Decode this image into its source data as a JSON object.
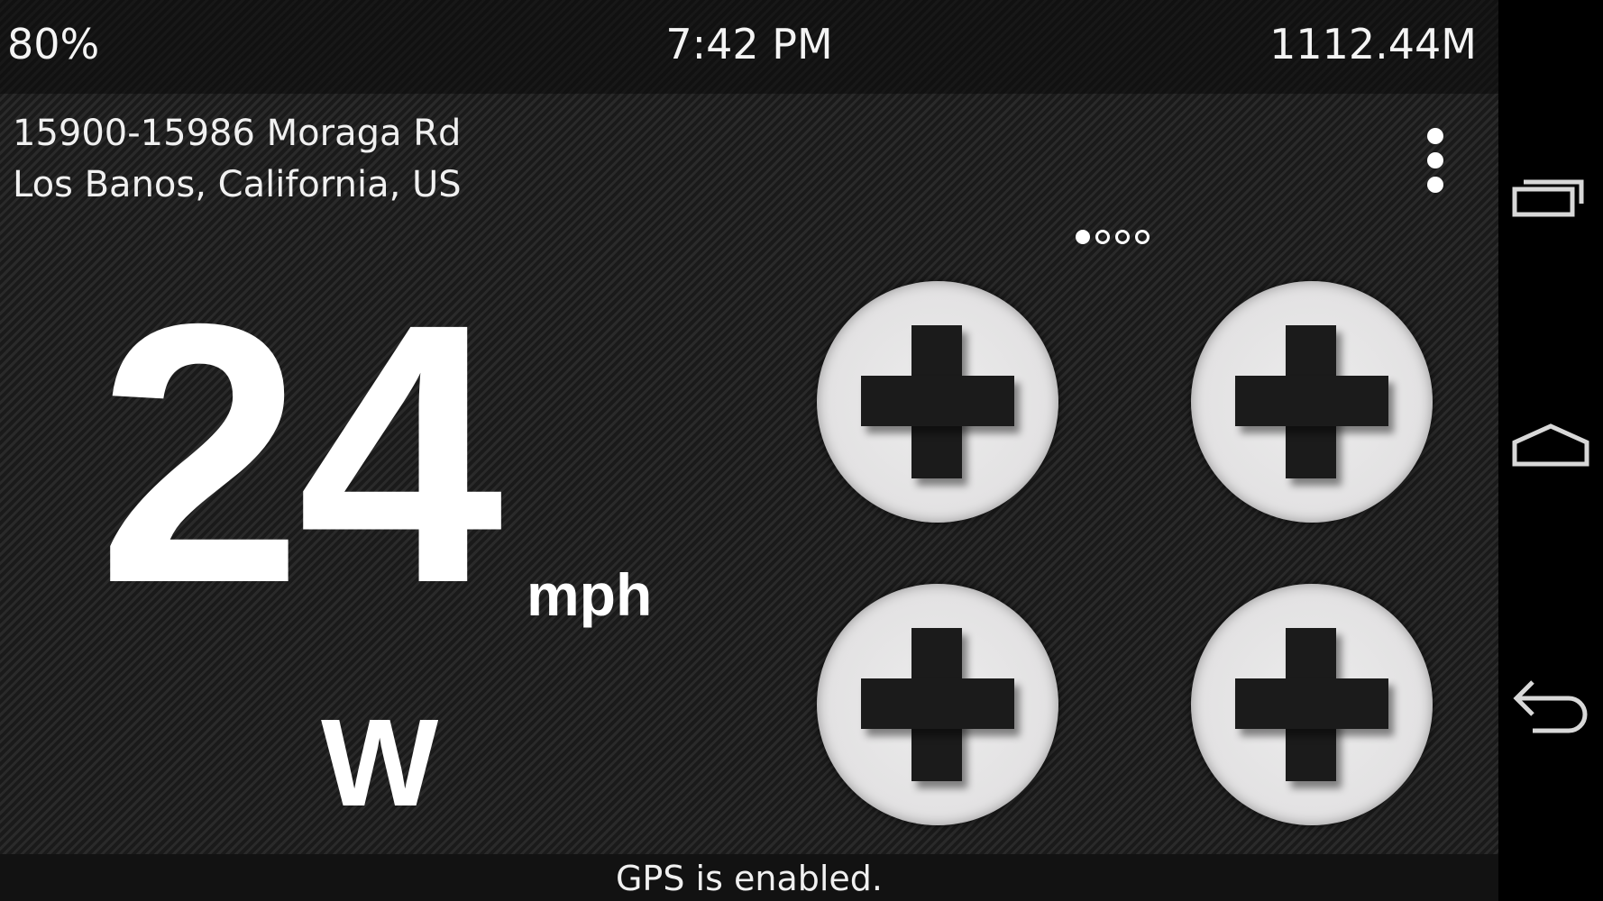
{
  "status_bar": {
    "battery": "80%",
    "time": "7:42 PM",
    "altitude": "1112.44M"
  },
  "location": {
    "street": "15900-15986 Moraga Rd",
    "city": "Los Banos, California, US"
  },
  "menu": {
    "icon": "overflow-menu-icon"
  },
  "pager": {
    "page_count": 4,
    "active_page": 1
  },
  "speedometer": {
    "speed": "24",
    "unit": "mph",
    "heading": "W"
  },
  "widget_slots": [
    {
      "icon": "add-icon"
    },
    {
      "icon": "add-icon"
    },
    {
      "icon": "add-icon"
    },
    {
      "icon": "add-icon"
    }
  ],
  "toast": {
    "message": "GPS is enabled."
  },
  "nav_bar": {
    "buttons": [
      "recents-icon",
      "home-icon",
      "back-icon"
    ]
  },
  "colors": {
    "background": "#1f1f1f",
    "text": "#ffffff",
    "slot_fill": "#e2e1e2",
    "plus": "#1b1b1b",
    "nav_bar": "#000000"
  }
}
